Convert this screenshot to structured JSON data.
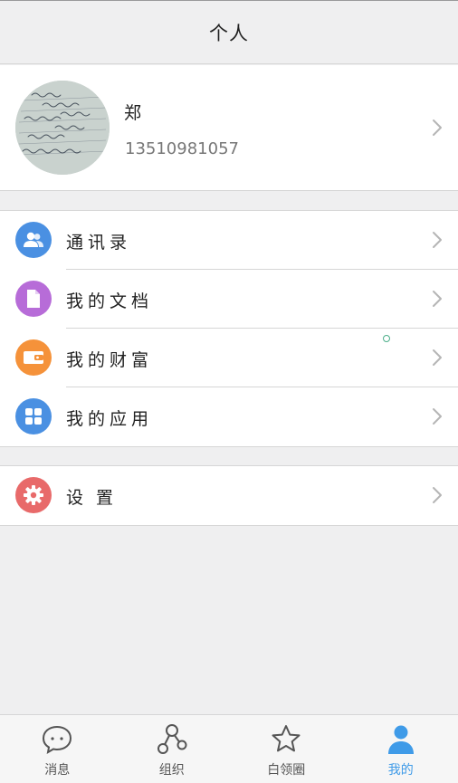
{
  "header": {
    "title": "个人"
  },
  "profile": {
    "name": "郑",
    "phone": "13510981057"
  },
  "menu_group_1": [
    {
      "label": "通讯录",
      "icon": "contacts-icon",
      "color": "#4a90e2"
    },
    {
      "label": "我的文档",
      "icon": "document-icon",
      "color": "#b76cd8"
    },
    {
      "label": "我的财富",
      "icon": "wallet-icon",
      "color": "#f5923a"
    },
    {
      "label": "我的应用",
      "icon": "apps-icon",
      "color": "#4a90e2"
    }
  ],
  "menu_group_2": [
    {
      "label": "设置",
      "icon": "gear-icon",
      "color": "#e86a6a"
    }
  ],
  "tabbar": {
    "items": [
      {
        "label": "消息",
        "icon": "chat-bubble-icon",
        "active": false
      },
      {
        "label": "组织",
        "icon": "organization-icon",
        "active": false
      },
      {
        "label": "白领圈",
        "icon": "star-icon",
        "active": false
      },
      {
        "label": "我的",
        "icon": "person-icon",
        "active": true
      }
    ],
    "active_color": "#3f9be8"
  }
}
